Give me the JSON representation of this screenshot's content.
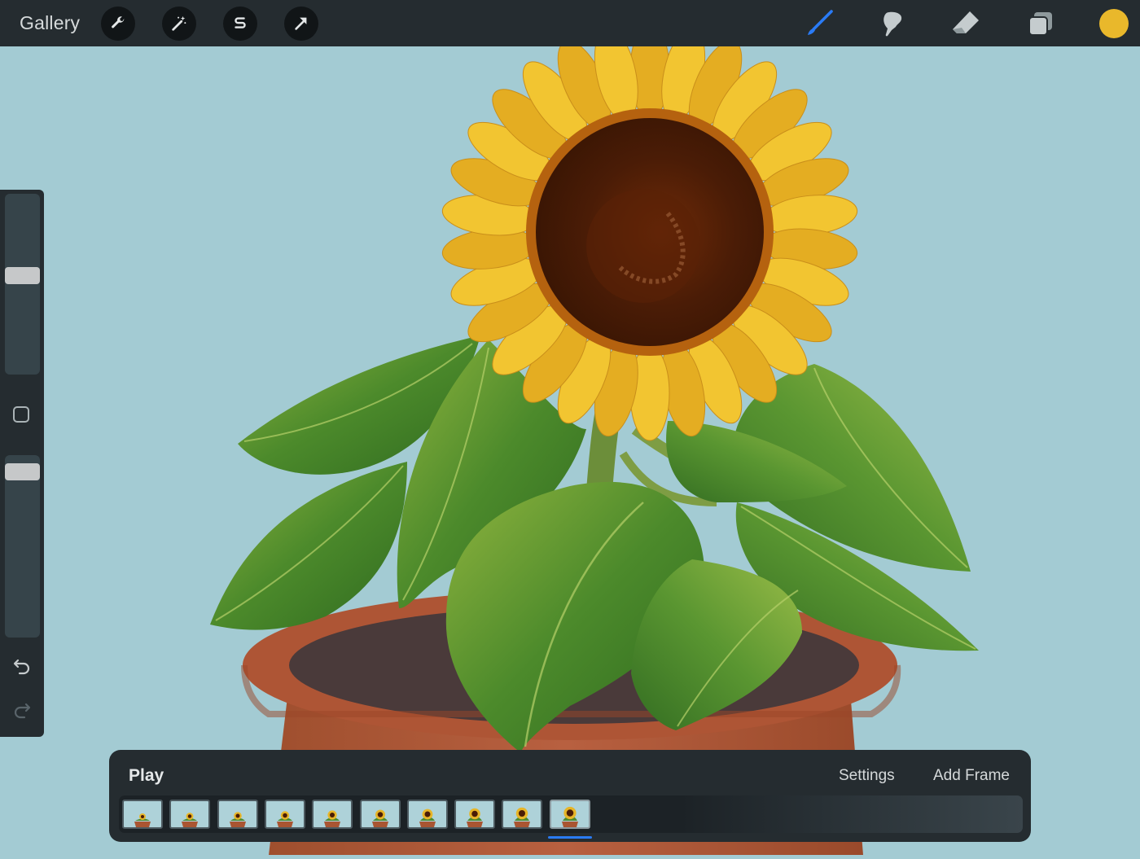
{
  "topbar": {
    "gallery_label": "Gallery",
    "left_tools": [
      "wrench-icon",
      "magic-wand-icon",
      "selection-s-icon",
      "transform-arrow-icon"
    ],
    "right_tools": [
      "brush-icon",
      "smudge-icon",
      "eraser-icon",
      "layers-icon"
    ],
    "active_tool": "brush-icon",
    "accent_color": "#2a7bf6",
    "current_color": "#e9b82b"
  },
  "sidebar": {
    "brush_size_level": 0.55,
    "opacity_level": 0.95,
    "icons": [
      "modify-square-icon",
      "undo-icon",
      "redo-icon"
    ]
  },
  "canvas": {
    "background_color": "#a3cbd3",
    "subject": "sunflower-in-pot-painting"
  },
  "animation": {
    "play_label": "Play",
    "settings_label": "Settings",
    "add_frame_label": "Add Frame",
    "frame_count": 10,
    "active_frame": 10
  }
}
